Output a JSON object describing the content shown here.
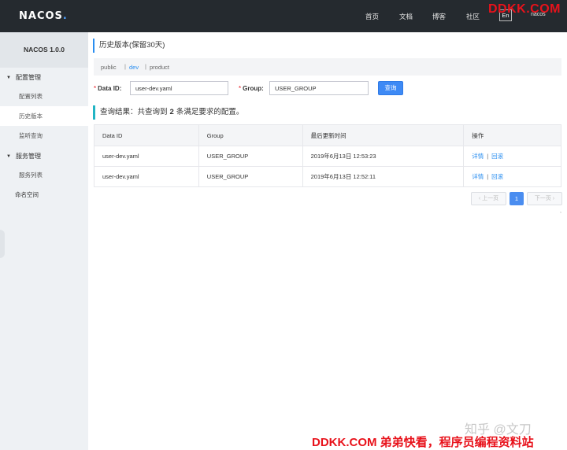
{
  "header": {
    "logo": "NACOS",
    "logo_dot": ".",
    "nav": [
      "首页",
      "文档",
      "博客",
      "社区"
    ],
    "lang": "En",
    "user": "nacos",
    "watermark": "DDKK.COM"
  },
  "sidebar": {
    "title": "NACOS 1.0.0",
    "config_group": "配置管理",
    "config_items": [
      "配置列表",
      "历史版本",
      "监听查询"
    ],
    "service_group": "服务管理",
    "service_items": [
      "服务列表"
    ],
    "namespace": "命名空间"
  },
  "main": {
    "title": "历史版本(保留30天)",
    "namespaces": [
      "public",
      "dev",
      "product"
    ],
    "active_namespace": "dev",
    "form": {
      "data_id_label": "Data ID:",
      "data_id_value": "user-dev.yaml",
      "group_label": "Group:",
      "group_value": "USER_GROUP",
      "query_label": "查询"
    },
    "result": {
      "prefix": "查询结果：共查询到",
      "count": "2",
      "suffix": "条满足要求的配置。"
    },
    "table": {
      "headers": [
        "Data ID",
        "Group",
        "最后更新时间",
        "操作"
      ],
      "rows": [
        {
          "data_id": "user-dev.yaml",
          "group": "USER_GROUP",
          "updated": "2019年6月13日 12:53:23",
          "detail": "详情",
          "rollback": "回滚"
        },
        {
          "data_id": "user-dev.yaml",
          "group": "USER_GROUP",
          "updated": "2019年6月13日 12:52:11",
          "detail": "详情",
          "rollback": "回滚"
        }
      ],
      "op_sep": "|"
    },
    "pagination": {
      "prev": "上一页",
      "page": "1",
      "next": "下一页"
    }
  },
  "watermarks": {
    "zhihu": "知乎 @文刀",
    "bottom": "DDKK.COM 弟弟快看，程序员编程资料站"
  }
}
